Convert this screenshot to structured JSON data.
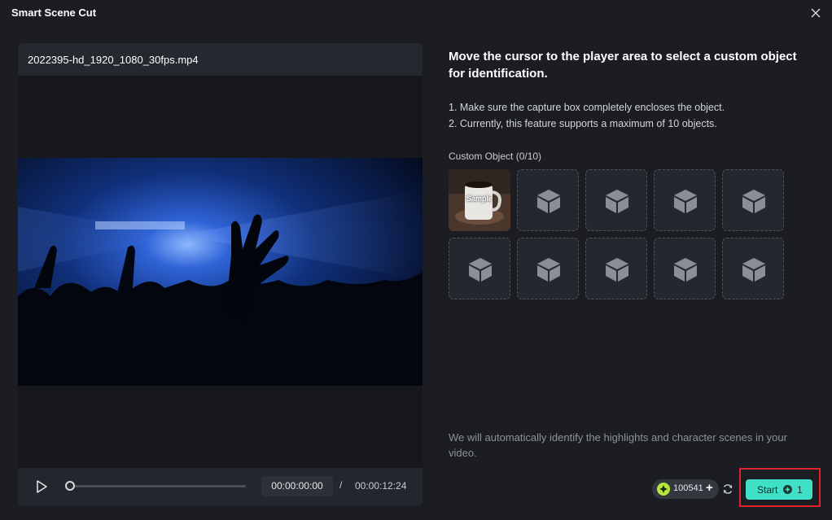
{
  "window": {
    "title": "Smart Scene Cut",
    "close_icon": "close-icon"
  },
  "player": {
    "filename": "2022395-hd_1920_1080_30fps.mp4",
    "current_time": "00:00:00:00",
    "separator": "/",
    "total_time": "00:00:12:24",
    "progress_fraction": 0.0,
    "play_icon": "play-icon"
  },
  "panel": {
    "heading": "Move the cursor to the player area to select a custom object for identification.",
    "tips": [
      "1. Make sure the capture box completely encloses the object.",
      "2. Currently, this feature supports a maximum of 10 objects."
    ],
    "custom_object_label": "Custom Object (0/10)",
    "sample_label": "Sample",
    "empty_slot_icon": "cube-icon",
    "footer_note": "We will automatically identify the highlights and character scenes in your video."
  },
  "actions": {
    "credits_value": "100541",
    "credits_plus": "+",
    "start_label": "Start",
    "start_cost": "1",
    "accent_color": "#3fe0c5",
    "highlight_color": "#e0202a"
  }
}
